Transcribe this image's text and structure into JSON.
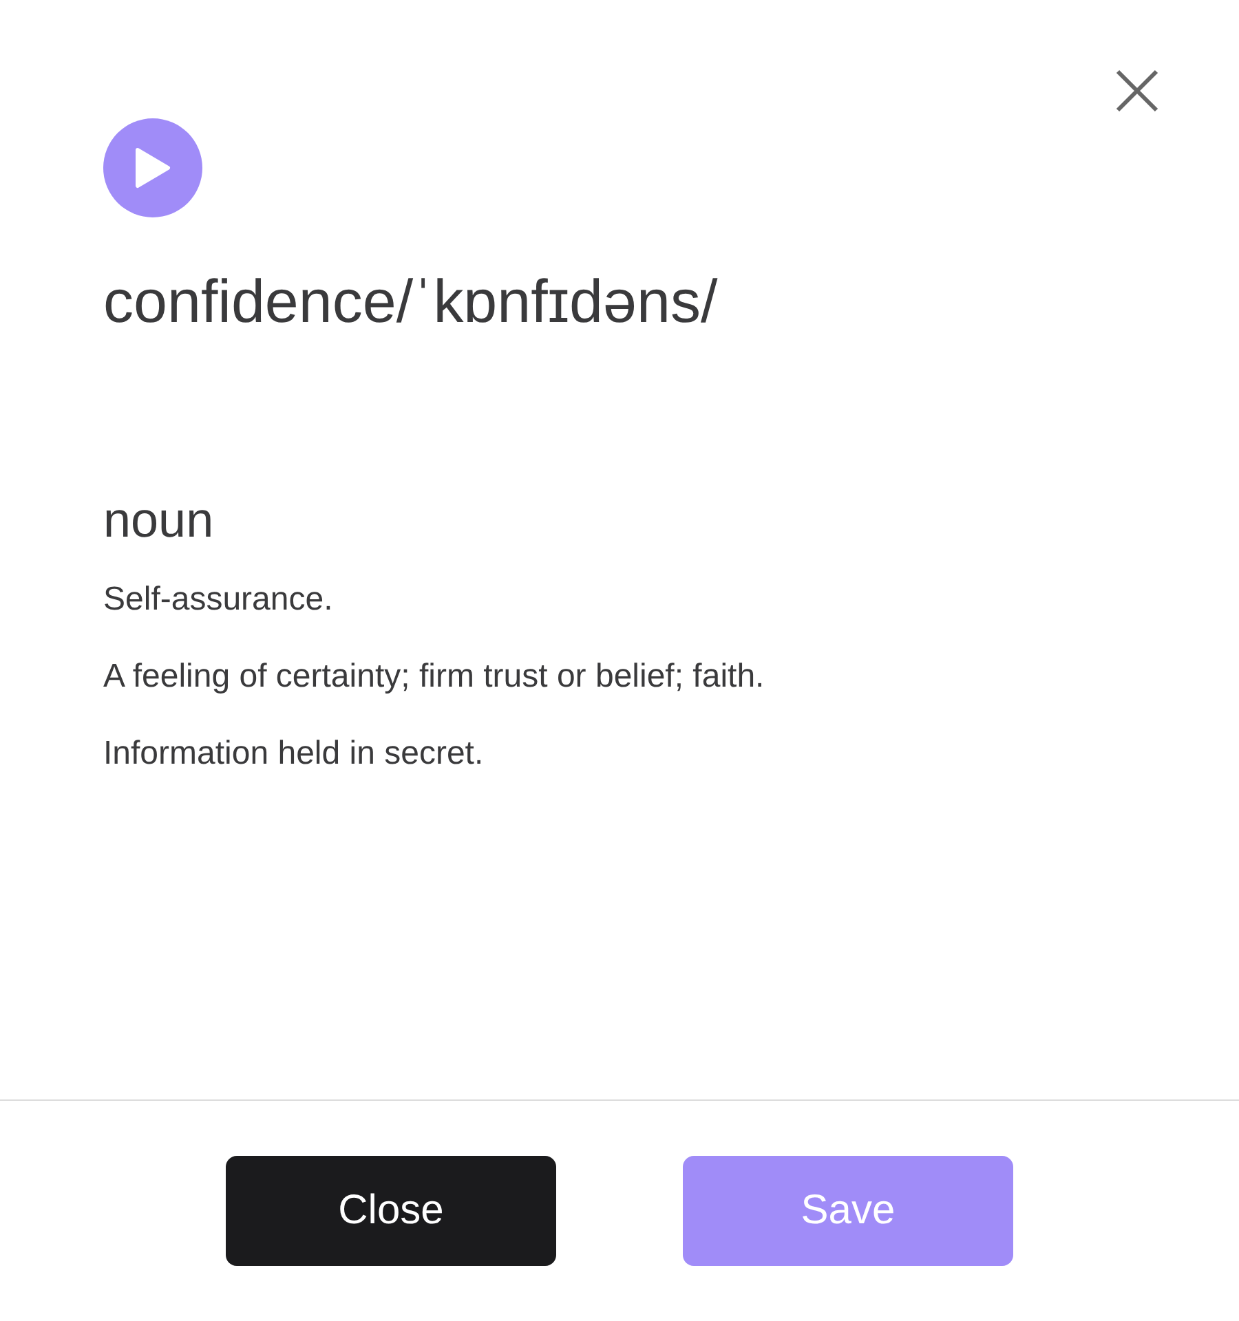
{
  "entry": {
    "word": "confidence",
    "pronunciation": "/ˈkɒnfɪdəns/",
    "part_of_speech": "noun",
    "definitions": [
      "Self-assurance.",
      "A feeling of certainty; firm trust or belief; faith.",
      "Information held in secret."
    ]
  },
  "buttons": [
    {
      "label": "Close",
      "kind": "secondary"
    },
    {
      "label": "Save",
      "kind": "primary"
    }
  ]
}
